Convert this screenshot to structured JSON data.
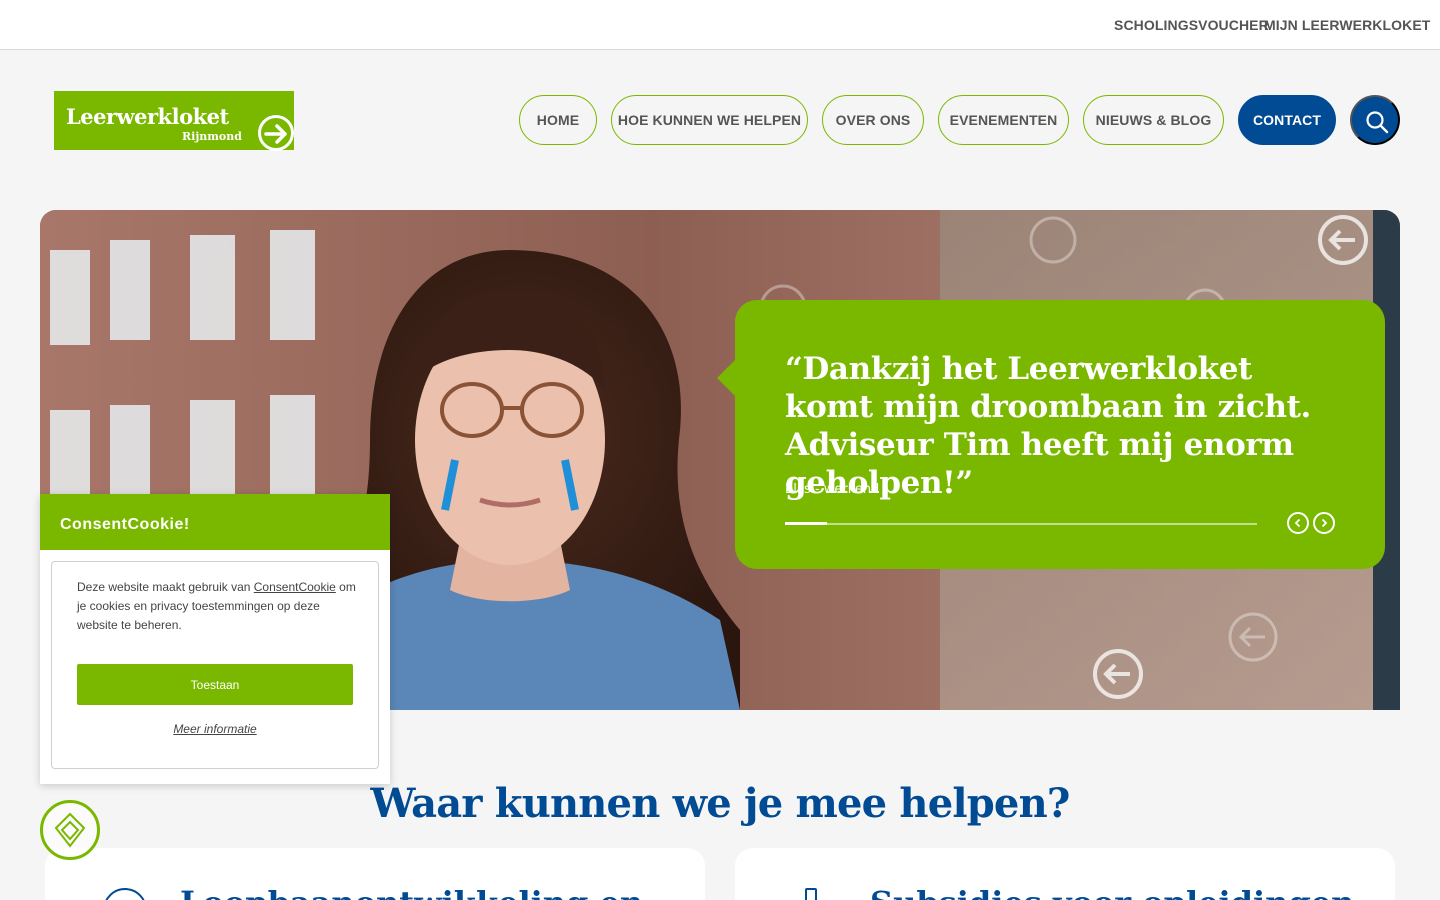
{
  "topbar": {
    "links": [
      "SCHOLINGSVOUCHER",
      "MIJN LEERWERKLOKET"
    ]
  },
  "logo": {
    "name": "Leerwerkloket",
    "sub": "Rijnmond"
  },
  "nav": {
    "items": [
      "HOME",
      "HOE KUNNEN WE HELPEN",
      "OVER ONS",
      "EVENEMENTEN",
      "NIEUWS & BLOG",
      "CONTACT"
    ],
    "search_icon": "search-icon"
  },
  "hero": {
    "quote": "“Dankzij het Leerwerkloket komt mijn droombaan in zicht. Adviseur Tim heeft mij enorm geholpen!”",
    "author": "Ellis - werkend",
    "progress": 0.09
  },
  "cookie": {
    "title": "ConsentCookie!",
    "text_before": "Deze website maakt gebruik van ",
    "link": "ConsentCookie",
    "text_after": " om je cookies en privacy toestemmingen op deze website te beheren.",
    "accept_label": "Toestaan",
    "more_label": "Meer informatie"
  },
  "section": {
    "title": "Waar kunnen we je mee helpen?",
    "cards": [
      "Loopbaanontwikkeling en",
      "Subsidies voor opleidingen"
    ]
  },
  "colors": {
    "brand_green": "#7ab800",
    "brand_blue": "#004b93"
  }
}
